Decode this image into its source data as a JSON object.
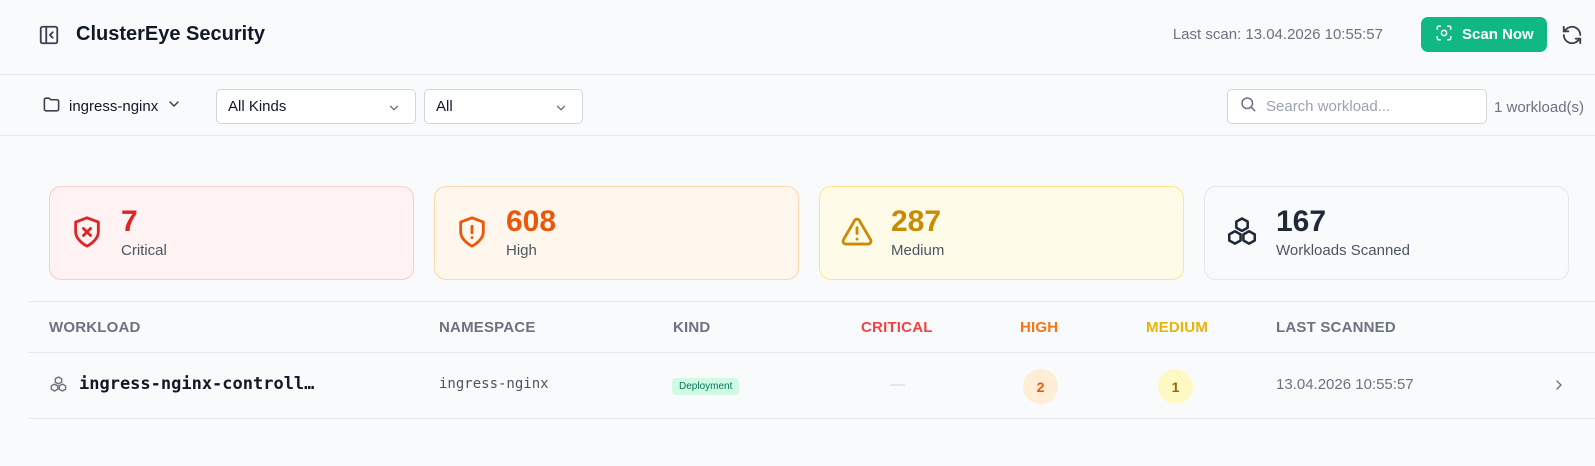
{
  "header": {
    "title": "ClusterEye Security",
    "last_scan": "Last scan: 13.04.2026 10:55:57",
    "scan_button": "Scan Now"
  },
  "filters": {
    "namespace": "ingress-nginx",
    "kind": "All Kinds",
    "severity": "All",
    "search_placeholder": "Search workload...",
    "workload_count": "1 workload(s)"
  },
  "summary": [
    {
      "value": "7",
      "label": "Critical",
      "icon": "shield-x-icon",
      "color": "#dc2626"
    },
    {
      "value": "608",
      "label": "High",
      "icon": "shield-alert-icon",
      "color": "#ea580c"
    },
    {
      "value": "287",
      "label": "Medium",
      "icon": "warning-triangle-icon",
      "color": "#ca8a04"
    },
    {
      "value": "167",
      "label": "Workloads Scanned",
      "icon": "boxes-icon",
      "color": "#1f2937"
    }
  ],
  "table": {
    "columns": [
      "WORKLOAD",
      "NAMESPACE",
      "KIND",
      "CRITICAL",
      "HIGH",
      "MEDIUM",
      "LAST SCANNED"
    ],
    "rows": [
      {
        "workload": "ingress-nginx-controll…",
        "namespace": "ingress-nginx",
        "kind": "Deployment",
        "critical": "—",
        "high": "2",
        "medium": "1",
        "last_scanned": "13.04.2026 10:55:57"
      }
    ]
  },
  "colors": {
    "accent": "#10b981",
    "critical": "#ef4444",
    "high": "#f97316",
    "medium": "#eab308"
  }
}
